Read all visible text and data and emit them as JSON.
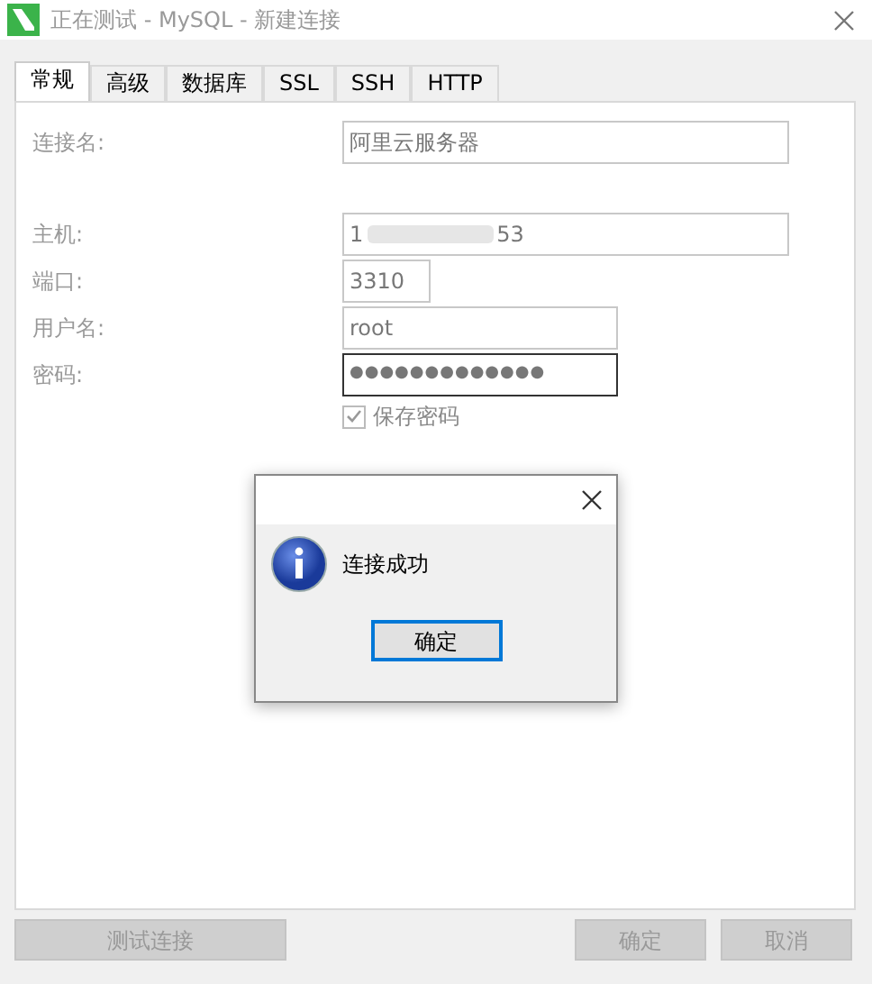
{
  "window": {
    "title": "正在测试 - MySQL - 新建连接"
  },
  "tabs": [
    {
      "label": "常规",
      "selected": true
    },
    {
      "label": "高级",
      "selected": false
    },
    {
      "label": "数据库",
      "selected": false
    },
    {
      "label": "SSL",
      "selected": false
    },
    {
      "label": "SSH",
      "selected": false
    },
    {
      "label": "HTTP",
      "selected": false
    }
  ],
  "fields": [
    {
      "label": "连接名:",
      "value": "阿里云服务器",
      "kind": "name"
    },
    {
      "label": "主机:",
      "value_prefix": "1",
      "value_suffix": "53",
      "kind": "host"
    },
    {
      "label": "端口:",
      "value": "3310",
      "kind": "port"
    },
    {
      "label": "用户名:",
      "value": "root",
      "kind": "user"
    },
    {
      "label": "密码:",
      "value": "●●●●●●●●●●●●●",
      "kind": "password",
      "focused": true
    }
  ],
  "save_password": {
    "label": "保存密码",
    "checked": true
  },
  "message_box": {
    "message": "连接成功",
    "ok": "确定"
  },
  "buttons": {
    "test": "测试连接",
    "ok": "确定",
    "cancel": "取消"
  }
}
